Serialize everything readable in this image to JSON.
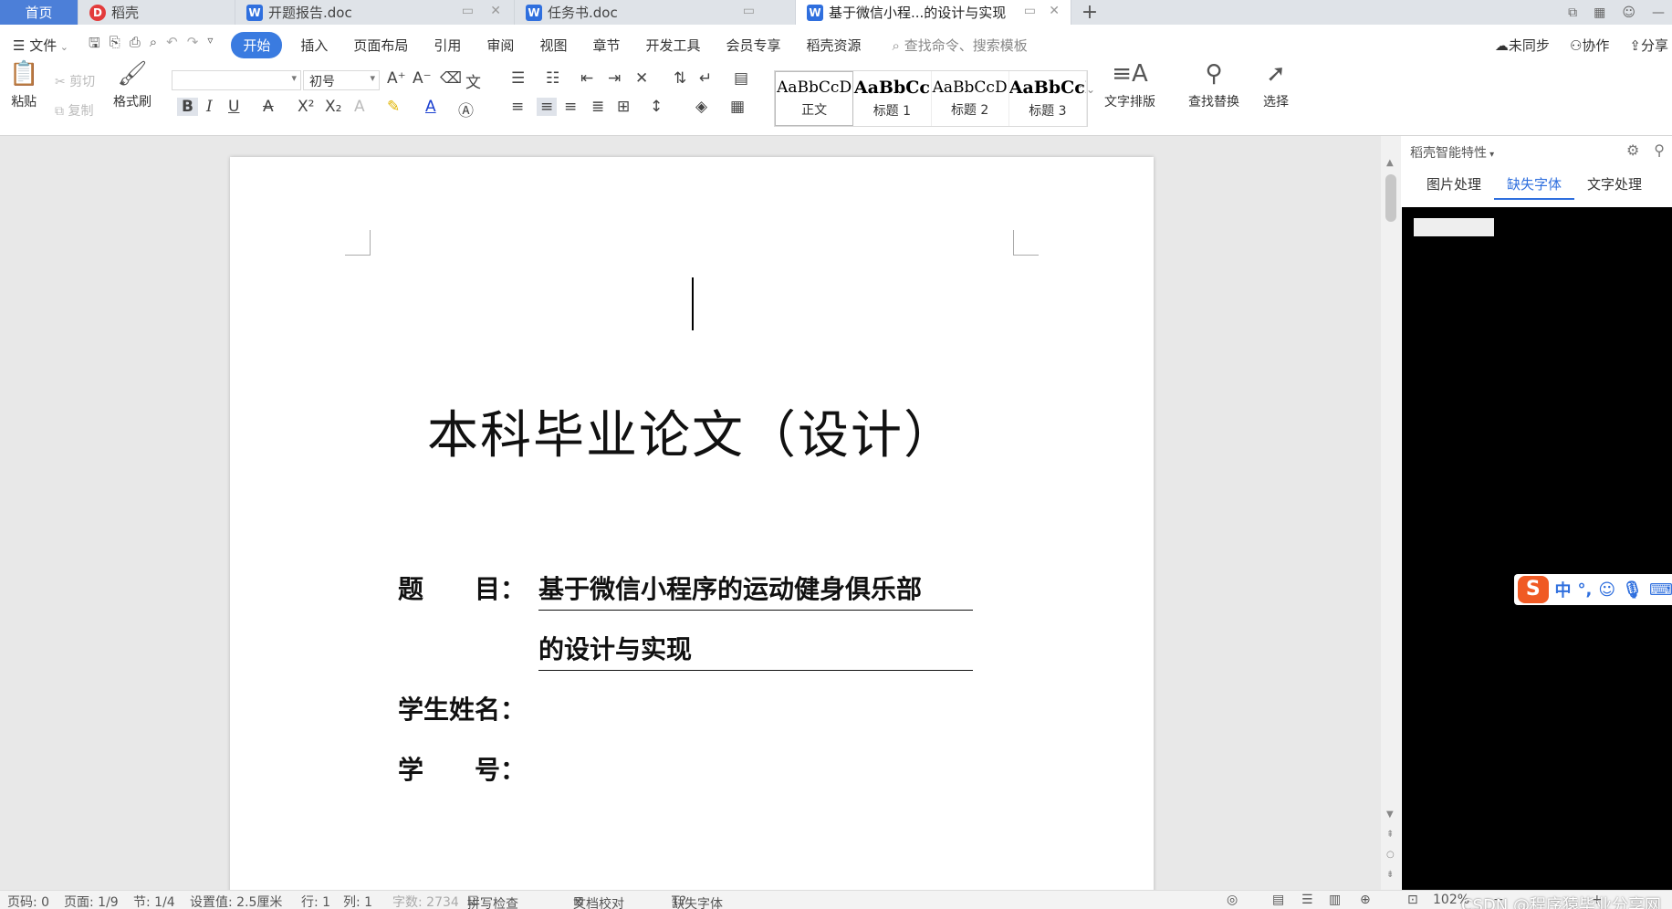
{
  "tabs": [
    {
      "label": "首页",
      "kind": "home"
    },
    {
      "label": "稻壳",
      "kind": "docer"
    },
    {
      "label": "开题报告.doc",
      "kind": "word"
    },
    {
      "label": "任务书.doc",
      "kind": "word"
    },
    {
      "label": "基于微信小程...的设计与实现",
      "kind": "word-active"
    }
  ],
  "add_tab_label": "+",
  "menu": {
    "file": "文件",
    "items": [
      "开始",
      "插入",
      "页面布局",
      "引用",
      "审阅",
      "视图",
      "章节",
      "开发工具",
      "会员专享",
      "稻壳资源"
    ],
    "active": "开始",
    "search_placeholder": "查找命令、搜索模板",
    "sync": "未同步",
    "collab": "协作",
    "share": "分享"
  },
  "toolbar": {
    "paste": "粘贴",
    "cut": "剪切",
    "copy": "复制",
    "format_painter": "格式刷",
    "font_name": "",
    "font_size": "初号",
    "style_previews": [
      "AaBbCcD",
      "AaBbCc",
      "AaBbCcD",
      "AaBbCcI"
    ],
    "style_names": [
      "正文",
      "标题 1",
      "标题 2",
      "标题 3"
    ],
    "text_layout": "文字排版",
    "find_replace": "查找替换",
    "select": "选择"
  },
  "document": {
    "title": "本科毕业论文（设计）",
    "fields": [
      {
        "label": "题　　目：",
        "value": "基于微信小程序的运动健身俱乐部"
      },
      {
        "label": "",
        "value": "的设计与实现"
      },
      {
        "label": "学生姓名：",
        "value": ""
      },
      {
        "label": "学　　号：",
        "value": ""
      }
    ]
  },
  "right_panel": {
    "header": "稻壳智能特性",
    "tabs": [
      "图片处理",
      "缺失字体",
      "文字处理"
    ],
    "active_tab": "缺失字体"
  },
  "ime": {
    "logo": "S",
    "mode": "中"
  },
  "status": {
    "page_num": "页码: 0",
    "pages": "页面: 1/9",
    "section": "节: 1/4",
    "setting": "设置值: 2.5厘米",
    "line": "行: 1",
    "col": "列: 1",
    "word_count": "字数: 2734",
    "spellcheck": "拼写检查",
    "doc_proof": "文档校对",
    "missing_font": "缺失字体",
    "zoom": "102%"
  },
  "watermark": "CSDN @程序猿毕业分享网"
}
